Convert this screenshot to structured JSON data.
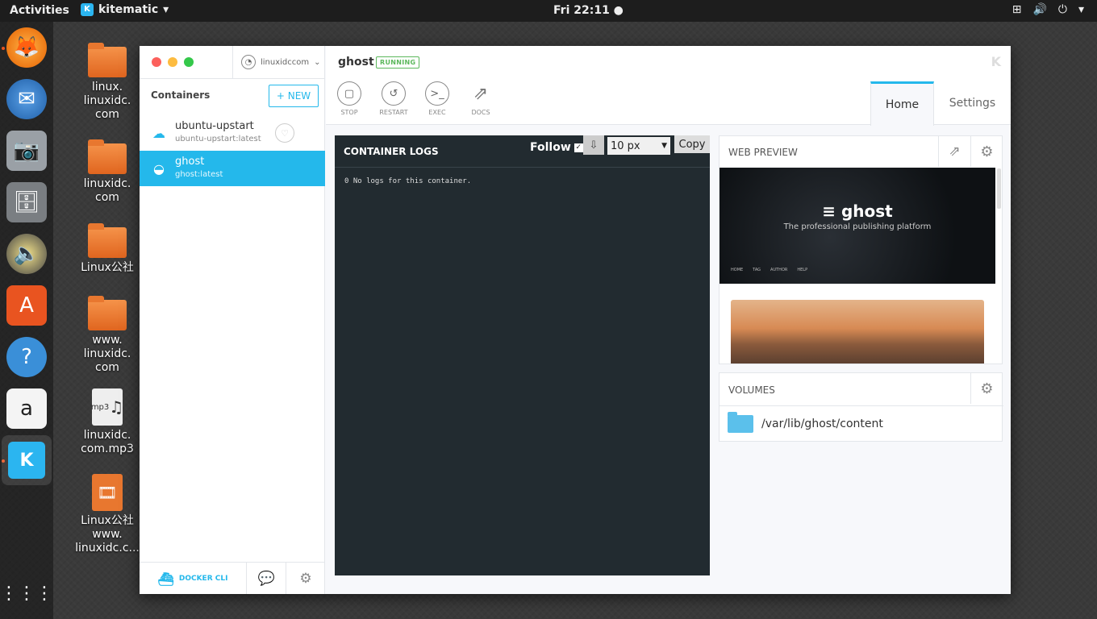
{
  "topbar": {
    "activities": "Activities",
    "app_name": "kitematic",
    "app_icon_text": "K",
    "clock": "Fri 22:11 ●",
    "icons": [
      "network-icon",
      "volume-icon",
      "power-icon",
      "chevron-down-icon"
    ]
  },
  "desktop": {
    "icons": [
      {
        "label": "linux.\nlinuxidc.\ncom"
      },
      {
        "label": "linuxidc.\ncom"
      },
      {
        "label": "Linux公社"
      },
      {
        "label": "www.\nlinuxidc.\ncom"
      },
      {
        "label": "linuxidc.\ncom.mp3"
      },
      {
        "label": "Linux公社\nwww.\nlinuxidc.c..."
      }
    ],
    "mp3_badge": "mp3"
  },
  "sidebar": {
    "user": "linuxidccom",
    "containers_title": "Containers",
    "new_label": "+ NEW",
    "items": [
      {
        "name": "ubuntu-upstart",
        "image": "ubuntu-upstart:latest"
      },
      {
        "name": "ghost",
        "image": "ghost:latest"
      }
    ],
    "docker_cli": "DOCKER CLI"
  },
  "header": {
    "container_name": "ghost",
    "status": "RUNNING",
    "actions": {
      "stop": "STOP",
      "restart": "RESTART",
      "exec": "EXEC",
      "docs": "DOCS"
    },
    "tabs": {
      "home": "Home",
      "settings": "Settings"
    }
  },
  "logs": {
    "title": "CONTAINER LOGS",
    "follow_label": "Follow",
    "font_size": "10 px",
    "copy_label": "Copy",
    "text": "0 No logs for this container."
  },
  "preview": {
    "title": "WEB PREVIEW",
    "brand": "ghost",
    "tagline": "The professional publishing platform",
    "nav": [
      "HOME",
      "TAG",
      "AUTHOR",
      "HELP"
    ]
  },
  "volumes": {
    "title": "VOLUMES",
    "path": "/var/lib/ghost/content"
  },
  "colors": {
    "accent": "#24b8eb",
    "running": "#5cb85c",
    "logs_bg": "#222b30"
  }
}
